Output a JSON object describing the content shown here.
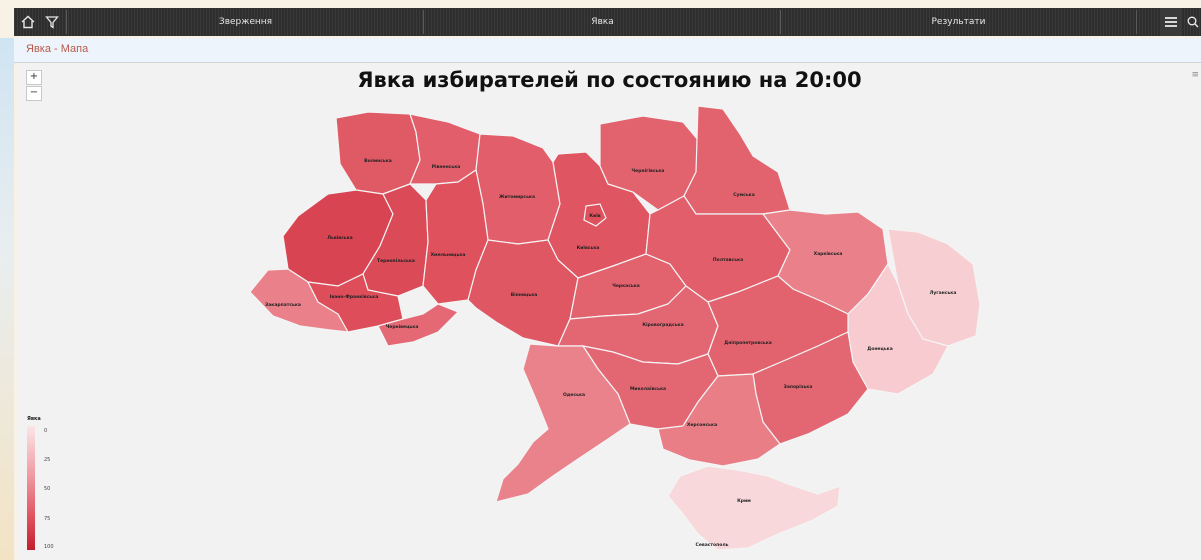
{
  "topbar": {
    "home_icon": "home-icon",
    "filter_icon": "filter-icon",
    "menu_icon": "menu-icon",
    "tabs": [
      "Зверження",
      "Явка",
      "Результати"
    ]
  },
  "breadcrumb": "Явка - Мапа",
  "map": {
    "title": "Явка избирателей по состоянию на 20:00",
    "zoom_in": "+",
    "zoom_out": "−",
    "legend": {
      "title": "Явка",
      "ticks": [
        "0",
        "25",
        "50",
        "75",
        "100"
      ],
      "colors": [
        "#fbe6e8",
        "#ef9aa2",
        "#de4f5c",
        "#c41e2e"
      ]
    },
    "regions": [
      {
        "id": "volyn",
        "label": "Волинська",
        "turnout": 62
      },
      {
        "id": "rivne",
        "label": "Рівненська",
        "turnout": 60
      },
      {
        "id": "zhytomyr",
        "label": "Житомирська",
        "turnout": 60
      },
      {
        "id": "kyiv_obl",
        "label": "Київська",
        "turnout": 64
      },
      {
        "id": "kyiv_city",
        "label": "Київ",
        "turnout": 66
      },
      {
        "id": "chernihiv",
        "label": "Чернігівська",
        "turnout": 58
      },
      {
        "id": "sumy",
        "label": "Сумська",
        "turnout": 58
      },
      {
        "id": "lviv",
        "label": "Львівська",
        "turnout": 74
      },
      {
        "id": "ternopil",
        "label": "Тернопільська",
        "turnout": 70
      },
      {
        "id": "khmelnytskyi",
        "label": "Хмельницька",
        "turnout": 66
      },
      {
        "id": "vinnytsia",
        "label": "Вінницька",
        "turnout": 63
      },
      {
        "id": "cherkasy",
        "label": "Черкаська",
        "turnout": 58
      },
      {
        "id": "poltava",
        "label": "Полтавська",
        "turnout": 60
      },
      {
        "id": "kharkiv",
        "label": "Харківська",
        "turnout": 45
      },
      {
        "id": "luhansk",
        "label": "Луганська",
        "turnout": 10
      },
      {
        "id": "donetsk",
        "label": "Донецька",
        "turnout": 12
      },
      {
        "id": "zakarpattia",
        "label": "Закарпатська",
        "turnout": 45
      },
      {
        "id": "ivano_frankivsk",
        "label": "Івано-Франківська",
        "turnout": 68
      },
      {
        "id": "chernivtsi",
        "label": "Чернівецька",
        "turnout": 55
      },
      {
        "id": "kirovohrad",
        "label": "Кіровоградська",
        "turnout": 56
      },
      {
        "id": "dnipropetrovsk",
        "label": "Дніпропетровська",
        "turnout": 58
      },
      {
        "id": "zaporizhzhia",
        "label": "Запорізька",
        "turnout": 56
      },
      {
        "id": "mykolaiv",
        "label": "Миколаївська",
        "turnout": 56
      },
      {
        "id": "odesa",
        "label": "Одеська",
        "turnout": 44
      },
      {
        "id": "kherson",
        "label": "Херсонська",
        "turnout": 46
      },
      {
        "id": "crimea",
        "label": "Крим",
        "turnout": 6
      },
      {
        "id": "sevastopol",
        "label": "Севастополь",
        "turnout": 6
      }
    ]
  }
}
